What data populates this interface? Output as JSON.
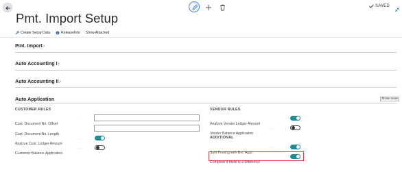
{
  "header": {
    "title": "Pmt. Import Setup",
    "status": "SAVED"
  },
  "actions": [
    {
      "label": "Create Setup Data",
      "icon": "wrench-icon"
    },
    {
      "label": "ReleaseInfo",
      "icon": "info-icon"
    },
    {
      "label": "Show Attached",
      "icon": ""
    }
  ],
  "sections": {
    "pmt_import": "Pmt. Import",
    "auto_accounting_1": "Auto Accounting I",
    "auto_accounting_2": "Auto Accounting II",
    "auto_application": "Auto Application",
    "show_more": "Show more"
  },
  "customer_rules": {
    "heading": "CUSTOMER RULES",
    "fields": [
      {
        "label": "Cust. Document No. Offset",
        "type": "text",
        "value": ""
      },
      {
        "label": "Cust. Document No. Length",
        "type": "text",
        "value": ""
      },
      {
        "label": "Analyze Cust. Ledger Amount",
        "type": "toggle",
        "on": true
      },
      {
        "label": "Customer Balance Application",
        "type": "toggle",
        "on": false
      }
    ]
  },
  "vendor_rules": {
    "heading": "VENDOR RULES",
    "fields": [
      {
        "label": "Analyze Vendor Ledger Amount",
        "type": "toggle",
        "on": true
      },
      {
        "label": "Vendor Balance Application",
        "type": "toggle",
        "on": false
      }
    ]
  },
  "additional": {
    "heading": "ADDITIONAL",
    "fields": [
      {
        "label": "Split Posting with Ext. Appl.",
        "type": "toggle",
        "on": true
      },
      {
        "label": "Complete if there is a difference",
        "type": "toggle",
        "on": true,
        "highlighted": true
      }
    ]
  },
  "colors": {
    "accent": "#1e8c96",
    "highlight_border": "#d43c3c",
    "link_blue": "#3a7fd9"
  }
}
